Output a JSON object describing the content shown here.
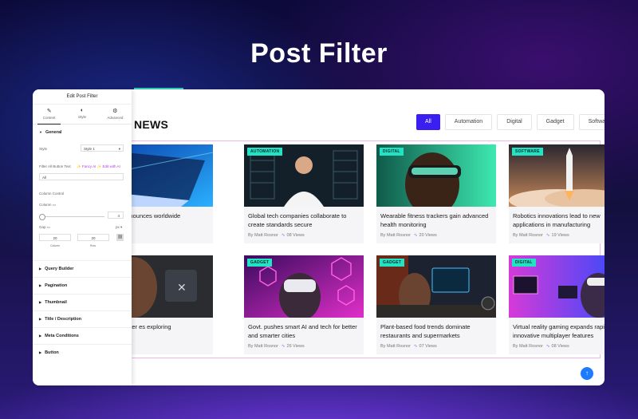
{
  "hero": {
    "title": "Post Filter"
  },
  "news": {
    "heading": "NEWS"
  },
  "filters": [
    {
      "label": "All",
      "active": true
    },
    {
      "label": "Automation",
      "active": false
    },
    {
      "label": "Digital",
      "active": false
    },
    {
      "label": "Gadget",
      "active": false
    },
    {
      "label": "Software",
      "active": false
    }
  ],
  "cards": [
    {
      "badge": "",
      "title": "g service announces worldwide",
      "author": "",
      "views": "iews",
      "theme": "laptop"
    },
    {
      "badge": "AUTOMATION",
      "title": "Global tech companies collaborate to create standards secure",
      "author": "By Matt Rosnor",
      "views": "08 Views",
      "theme": "man"
    },
    {
      "badge": "DIGITAL",
      "title": "Wearable fitness trackers gain advanced health monitoring",
      "author": "By Matt Rosnor",
      "views": "20 Views",
      "theme": "vr"
    },
    {
      "badge": "SOFTWARE",
      "title": "Robotics innovations lead to new applications in manufacturing",
      "author": "By Matt Rosnor",
      "views": "19 Views",
      "theme": "rocket"
    },
    {
      "badge": "",
      "title": "brain computer es exploring",
      "author": "",
      "views": "iews",
      "theme": "brain"
    },
    {
      "badge": "GADGET",
      "title": "Govt. pushes smart AI and tech for better and smarter cities",
      "author": "By Matt Rosnor",
      "views": "26 Views",
      "theme": "neon"
    },
    {
      "badge": "GADGET",
      "title": "Plant-based food trends dominate restaurants and supermarkets",
      "author": "By Matt Rosnor",
      "views": "07 Views",
      "theme": "desk"
    },
    {
      "badge": "DIGITAL",
      "title": "Virtual reality gaming expands rapidly with innovative multiplayer features",
      "author": "By Matt Rosnor",
      "views": "08 Views",
      "theme": "gaming"
    }
  ],
  "panel": {
    "title": "Edit Post Filter",
    "tabs": [
      {
        "label": "Content",
        "icon": "✎"
      },
      {
        "label": "Style",
        "icon": "◐"
      },
      {
        "label": "Advanced",
        "icon": "⚙"
      }
    ],
    "general": "General",
    "style_label": "Style",
    "style_value": "Style 1",
    "filter_all_label": "Filter All Button Text",
    "ai_links": "✨ Fancy AI ✨ Edit with AI",
    "filter_all_value": "All",
    "column_control": "Column Control",
    "column_label": "Column",
    "column_value": "4",
    "gap_label": "Gap",
    "gap_unit": "px ▾",
    "gap_column": "20",
    "gap_row": "20",
    "gap_column_label": "Column",
    "gap_row_label": "Row",
    "sections": [
      "Query Builder",
      "Pagination",
      "Thumbnail",
      "Title / Description",
      "Meta Conditions",
      "Button"
    ]
  }
}
